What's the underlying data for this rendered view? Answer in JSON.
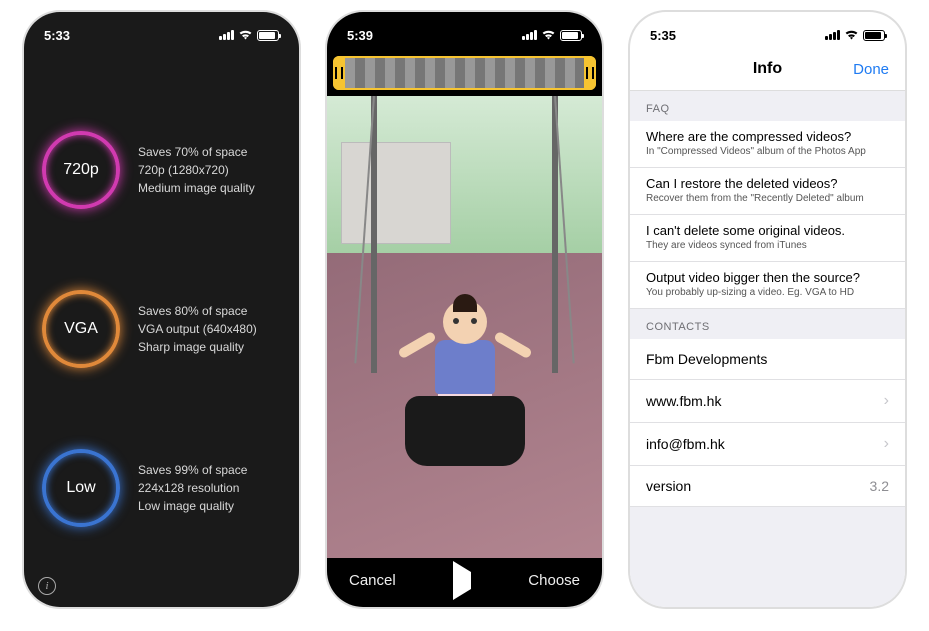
{
  "phone1": {
    "time": "5:33",
    "options": [
      {
        "label": "720p",
        "ring_color": "#d13ab0",
        "line1": "Saves 70% of space",
        "line2": "720p (1280x720)",
        "line3": "Medium image quality"
      },
      {
        "label": "VGA",
        "ring_color": "#e0893a",
        "line1": "Saves 80% of space",
        "line2": "VGA output (640x480)",
        "line3": "Sharp image quality"
      },
      {
        "label": "Low",
        "ring_color": "#3a74d1",
        "line1": "Saves 99% of space",
        "line2": "224x128 resolution",
        "line3": "Low image quality"
      }
    ]
  },
  "phone2": {
    "time": "5:39",
    "cancel": "Cancel",
    "choose": "Choose"
  },
  "phone3": {
    "time": "5:35",
    "nav_title": "Info",
    "done": "Done",
    "faq_header": "FAQ",
    "faq": [
      {
        "q": "Where are the compressed videos?",
        "a": "In \"Compressed Videos\" album of the Photos App"
      },
      {
        "q": "Can I restore the deleted videos?",
        "a": "Recover them from the \"Recently Deleted\" album"
      },
      {
        "q": "I can't delete some original videos.",
        "a": "They are videos synced from iTunes"
      },
      {
        "q": "Output video bigger then the source?",
        "a": "You probably up-sizing a video. Eg. VGA to HD"
      }
    ],
    "contacts_header": "CONTACTS",
    "developer": "Fbm Developments",
    "website": "www.fbm.hk",
    "email": "info@fbm.hk",
    "version_label": "version",
    "version_value": "3.2"
  }
}
